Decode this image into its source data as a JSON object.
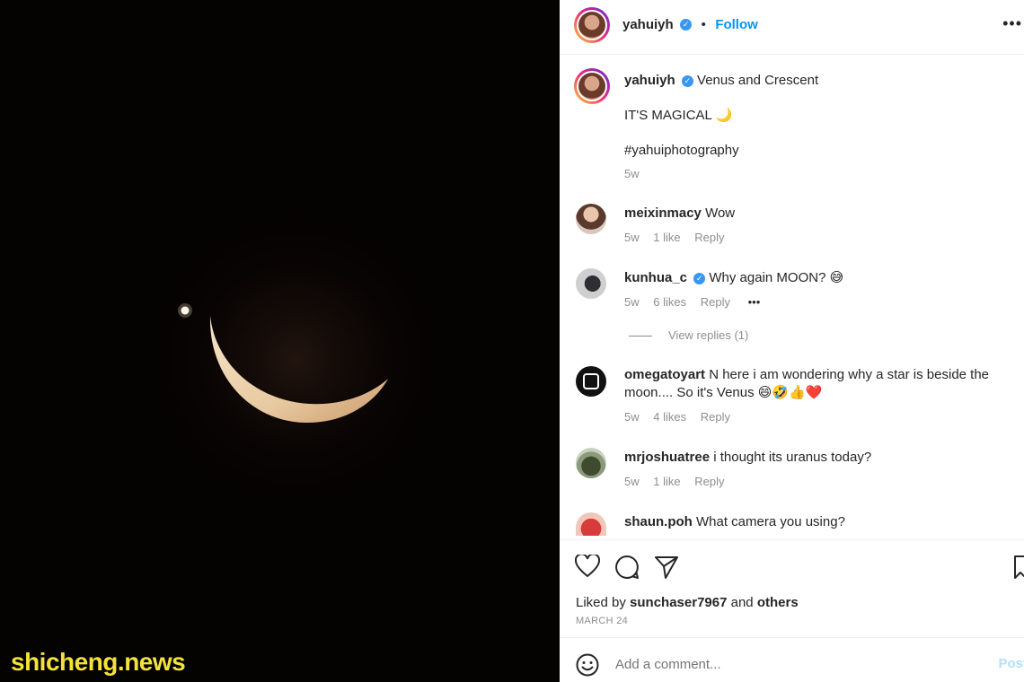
{
  "watermark": "shicheng.news",
  "post": {
    "username": "yahuiyh",
    "follow_label": "Follow",
    "separator": "•",
    "more_label": "•••"
  },
  "caption": {
    "username": "yahuiyh",
    "title": "Venus and Crescent",
    "line1": "IT'S MAGICAL 🌙",
    "hashtag": "#yahuiphotography",
    "time": "5w"
  },
  "comments": [
    {
      "username": "meixinmacy",
      "verified": false,
      "text": "Wow",
      "time": "5w",
      "likes": "1 like",
      "reply": "Reply"
    },
    {
      "username": "kunhua_c",
      "verified": true,
      "text": "Why again MOON? 😅",
      "time": "5w",
      "likes": "6 likes",
      "reply": "Reply",
      "more": "•••",
      "view_replies": "View replies (1)"
    },
    {
      "username": "omegatoyart",
      "verified": false,
      "text": "N here i am wondering why a star is beside the",
      "text2": "moon.... So it's Venus 😄🤣👍❤️",
      "time": "5w",
      "likes": "4 likes",
      "reply": "Reply"
    },
    {
      "username": "mrjoshuatree",
      "verified": false,
      "text": "i thought its uranus today?",
      "time": "5w",
      "likes": "1 like",
      "reply": "Reply"
    },
    {
      "username": "shaun.poh",
      "verified": false,
      "text": "What camera you using?"
    }
  ],
  "likes": {
    "prefix": "Liked by",
    "user": "sunchaser7967",
    "connector": "and",
    "others": "others"
  },
  "date": "MARCH 24",
  "comment_box": {
    "placeholder": "Add a comment...",
    "post_label": "Post"
  },
  "colors": {
    "accent": "#0095f6",
    "verified": "#3897f0",
    "muted": "#8e8e8e",
    "photo_bg": "#050202",
    "watermark": "#f3e23a"
  },
  "icons": [
    "heart-icon",
    "comment-icon",
    "share-icon",
    "bookmark-icon",
    "emoji-icon",
    "verified-icon",
    "more-icon"
  ]
}
